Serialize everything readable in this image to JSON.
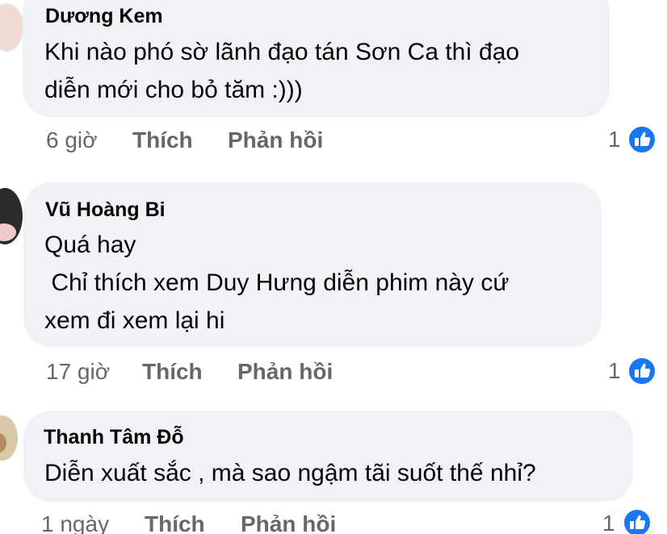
{
  "comments": [
    {
      "author": "Dương Kem",
      "lines": [
        "Khi nào phó sờ lãnh đạo tán Sơn Ca thì đạo",
        "diễn mới cho bỏ tăm :)))"
      ],
      "time": "6 giờ",
      "like_label": "Thích",
      "reply_label": "Phản hồi",
      "reaction_count": "1"
    },
    {
      "author": "Vũ Hoàng Bi",
      "lines": [
        "Quá hay",
        " Chỉ thích xem Duy Hưng diễn phim này cứ",
        "xem đi xem lại hi"
      ],
      "time": "17 giờ",
      "like_label": "Thích",
      "reply_label": "Phản hồi",
      "reaction_count": "1"
    },
    {
      "author": "Thanh Tâm Đỗ",
      "lines": [
        "Diễn xuất sắc , mà sao ngậm tãi suốt thế nhỉ?"
      ],
      "time": "1 ngày",
      "like_label": "Thích",
      "reply_label": "Phản hồi",
      "reaction_count": "1"
    }
  ],
  "colors": {
    "bubble": "#f0f2f5",
    "text": "#050505",
    "meta": "#65676b",
    "like_blue": "#1877f2"
  },
  "icons": {
    "reaction": "thumbs-up-icon"
  }
}
